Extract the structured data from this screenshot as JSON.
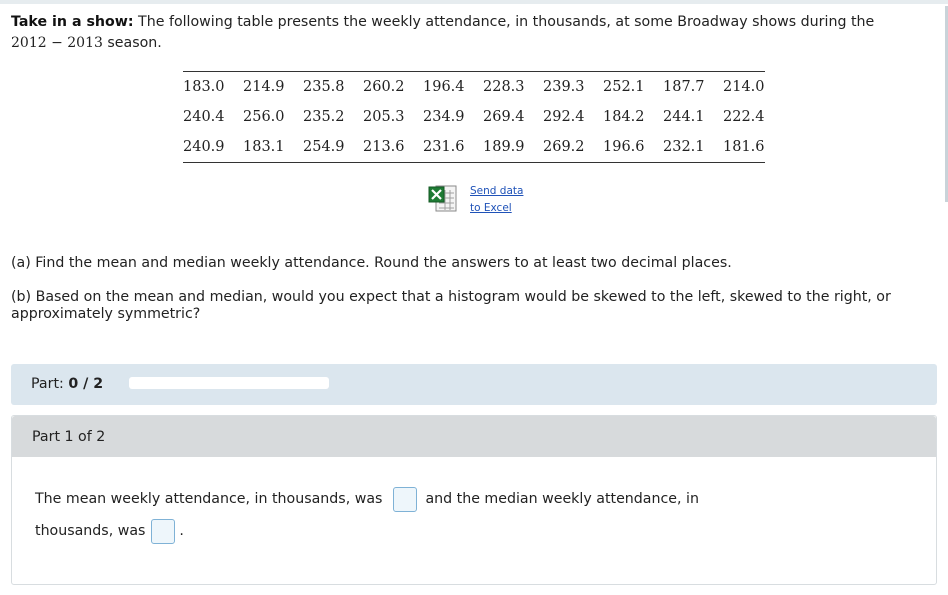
{
  "problem": {
    "title": "Take in a show:",
    "text": "The following table presents the weekly attendance, in thousands, at some Broadway shows during the",
    "season_year": "2012 − 2013",
    "season_word": "season."
  },
  "table": {
    "rows": [
      [
        "183.0",
        "214.9",
        "235.8",
        "260.2",
        "196.4",
        "228.3",
        "239.3",
        "252.1",
        "187.7",
        "214.0"
      ],
      [
        "240.4",
        "256.0",
        "235.2",
        "205.3",
        "234.9",
        "269.4",
        "292.4",
        "184.2",
        "244.1",
        "222.4"
      ],
      [
        "240.9",
        "183.1",
        "254.9",
        "213.6",
        "231.6",
        "189.9",
        "269.2",
        "196.6",
        "232.1",
        "181.6"
      ]
    ]
  },
  "excel": {
    "icon": "excel-icon",
    "link_line1": "Send data",
    "link_line2": "to Excel"
  },
  "questions": {
    "a": "(a) Find the mean and median weekly attendance. Round the answers to at least two decimal places.",
    "b_line1": "(b) Based on the mean and median, would you expect that a histogram would be skewed to the left, skewed to the right, or",
    "b_line2": "approximately symmetric?"
  },
  "progress": {
    "label": "Part:",
    "value_text": "0 / 2",
    "fraction": 0
  },
  "part": {
    "header": "Part 1 of 2",
    "sentence_1": "The mean weekly attendance, in thousands, was",
    "sentence_2": "and the median weekly attendance, in",
    "sentence_3": "thousands, was",
    "sentence_end": "."
  },
  "colors": {
    "link": "#1f52b8",
    "progress_bg": "#dbe6ee",
    "part_header_bg": "#d7dadc",
    "input_border": "#7fb2d6"
  }
}
